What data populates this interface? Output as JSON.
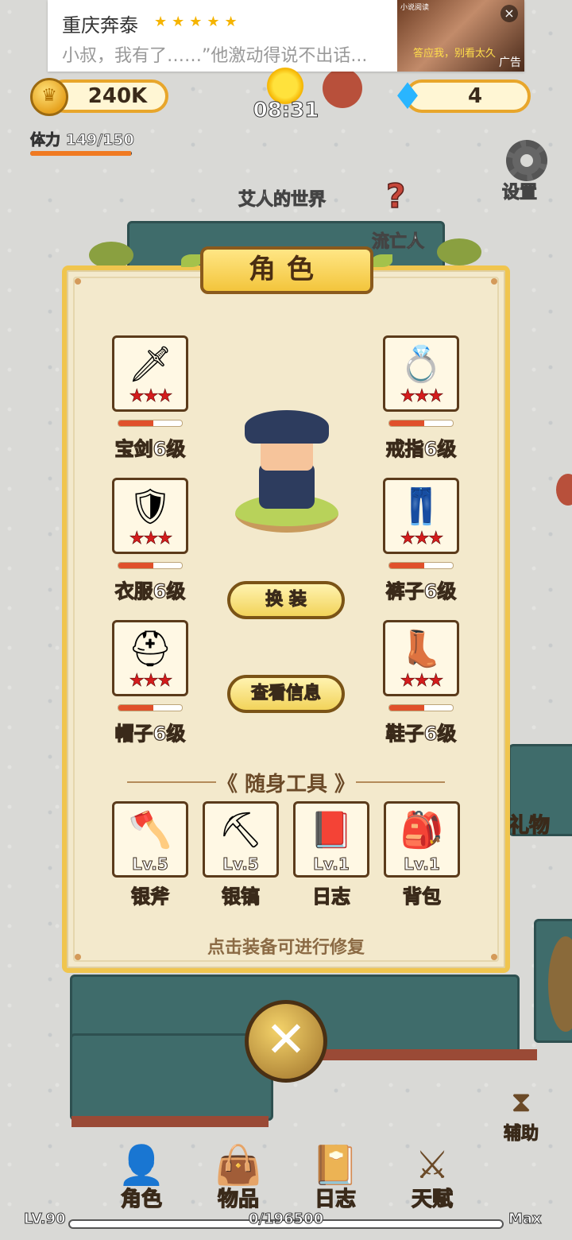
{
  "ad": {
    "title": "重庆奔泰",
    "stars": "★★★★★",
    "text": "小叔，我有了……”他激动得说不出话...",
    "source": "小说阅读",
    "image_caption": "答应我，别看太久",
    "tag": "广告",
    "close_icon": "×"
  },
  "hud": {
    "gold": "240K",
    "gems": "4",
    "clock": "08:31",
    "stamina_label": "体力 149/150",
    "stamina_ratio": 0.993,
    "settings_label": "设置"
  },
  "map": {
    "world_label": "艾人的世界",
    "exile_label": "流亡人",
    "gift_label": "礼物"
  },
  "panel": {
    "title": "角色",
    "equipment_left": [
      {
        "label": "宝剑6级",
        "icon": "sword-icon",
        "glyph": "🗡",
        "stars": "★★★",
        "durability": 0.55
      },
      {
        "label": "衣服6级",
        "icon": "armor-icon",
        "glyph": "🛡",
        "stars": "★★★",
        "durability": 0.55
      },
      {
        "label": "帽子6级",
        "icon": "helmet-icon",
        "glyph": "⛑",
        "stars": "★★★",
        "durability": 0.55
      }
    ],
    "equipment_right": [
      {
        "label": "戒指6级",
        "icon": "ring-icon",
        "glyph": "💍",
        "stars": "★★★",
        "durability": 0.55
      },
      {
        "label": "裤子6级",
        "icon": "pants-icon",
        "glyph": "👖",
        "stars": "★★★",
        "durability": 0.55
      },
      {
        "label": "鞋子6级",
        "icon": "boot-icon",
        "glyph": "👢",
        "stars": "★★★",
        "durability": 0.55
      }
    ],
    "change_outfit_label": "换 装",
    "view_info_label": "查看信息",
    "tools_header": "《 随身工具 》",
    "tools": [
      {
        "label": "银斧",
        "level": "Lv.5",
        "icon": "axe-icon",
        "glyph": "🪓"
      },
      {
        "label": "银镐",
        "level": "Lv.5",
        "icon": "pickaxe-icon",
        "glyph": "⛏"
      },
      {
        "label": "日志",
        "level": "Lv.1",
        "icon": "journal-icon",
        "glyph": "📕"
      },
      {
        "label": "背包",
        "level": "Lv.1",
        "icon": "backpack-icon",
        "glyph": "🎒"
      }
    ],
    "hint": "点击装备可进行修复",
    "close_icon": "✕"
  },
  "side": {
    "assist_label": "辅助"
  },
  "nav": [
    {
      "label": "角色",
      "icon": "character-icon",
      "glyph": "👤"
    },
    {
      "label": "物品",
      "icon": "bag-icon",
      "glyph": "👜"
    },
    {
      "label": "日志",
      "icon": "book-icon",
      "glyph": "📔"
    },
    {
      "label": "天赋",
      "icon": "wings-icon",
      "glyph": "⚔"
    }
  ],
  "xp": {
    "level": "LV.90",
    "progress": "0/196500",
    "max": "Max"
  }
}
